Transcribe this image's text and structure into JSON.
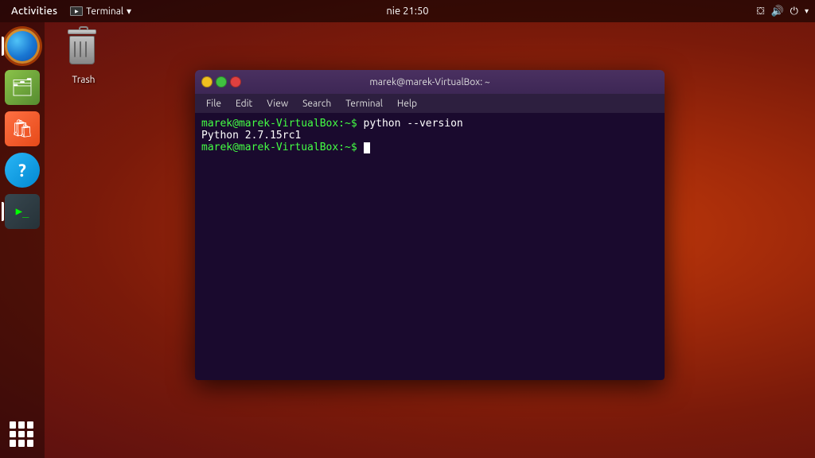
{
  "topbar": {
    "activities_label": "Activities",
    "terminal_app_label": "Terminal",
    "clock": "nie 21:50",
    "chevron": "▾"
  },
  "desktop": {
    "trash_label": "Trash"
  },
  "terminal_window": {
    "title": "marek@marek-VirtualBox: ~",
    "menubar": {
      "file": "File",
      "edit": "Edit",
      "view": "View",
      "search": "Search",
      "terminal": "Terminal",
      "help": "Help"
    },
    "lines": [
      {
        "prompt": "marek@marek-VirtualBox:~$",
        "command": " python --version"
      },
      {
        "output": "Python 2.7.15rc1"
      },
      {
        "prompt": "marek@marek-VirtualBox:~$",
        "command": " "
      }
    ]
  },
  "sidebar": {
    "apps": [
      {
        "name": "firefox",
        "label": "Firefox"
      },
      {
        "name": "files",
        "label": "Files"
      },
      {
        "name": "app-center",
        "label": "App Center"
      },
      {
        "name": "help",
        "label": "Help"
      },
      {
        "name": "terminal",
        "label": "Terminal"
      }
    ],
    "grid_label": "Show Applications"
  }
}
